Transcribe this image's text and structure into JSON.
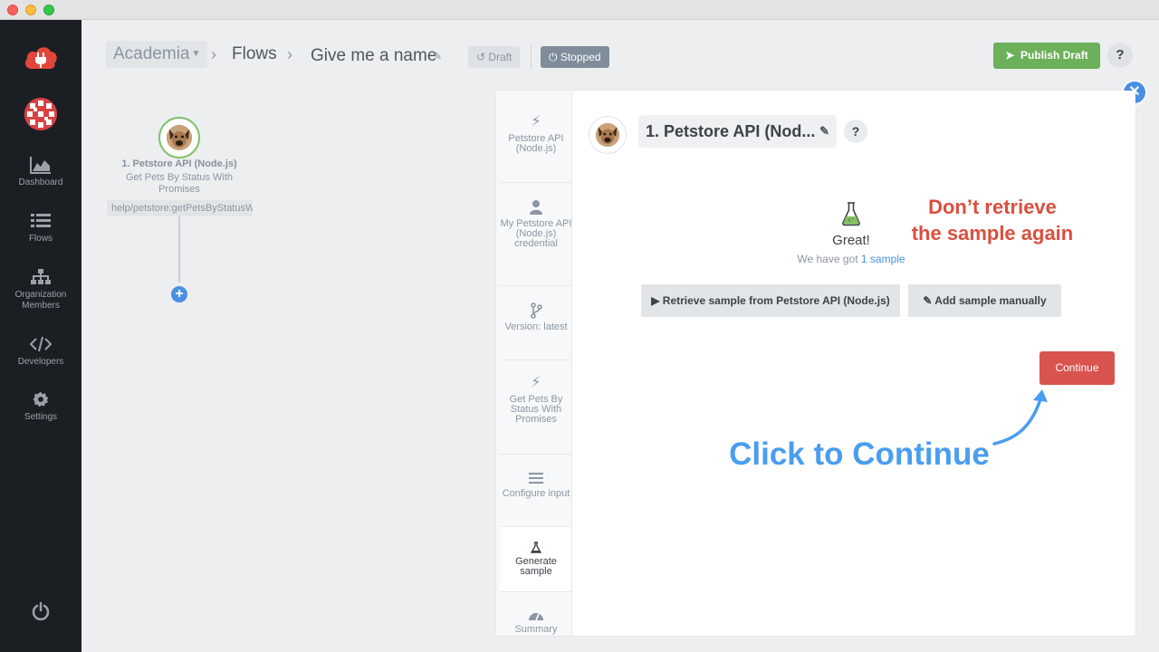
{
  "window": {
    "controls": [
      "close",
      "minimize",
      "zoom"
    ]
  },
  "sidebar": {
    "logo_icon": "cloud-plug-icon",
    "items": [
      {
        "label": "Dashboard",
        "icon": "area-chart-icon"
      },
      {
        "label": "Flows",
        "icon": "list-icon"
      },
      {
        "label": "Organization Members",
        "icon": "sitemap-icon"
      },
      {
        "label": "Developers",
        "icon": "code-icon"
      },
      {
        "label": "Settings",
        "icon": "gear-icon"
      }
    ],
    "power_icon": "power-icon"
  },
  "header": {
    "org": "Academia",
    "flows": "Flows",
    "flow_name": "Give me a name",
    "draft_badge": "Draft",
    "stopped_badge": "Stopped",
    "publish_label": "Publish Draft",
    "help_label": "?"
  },
  "canvas": {
    "node": {
      "title": "1. Petstore API (Node.js)",
      "subtitle": "Get Pets By Status With Promises",
      "path": "help/petstore:getPetsByStatusW"
    },
    "add_label": "+"
  },
  "panel": {
    "tabs": [
      {
        "label": "Petstore API (Node.js)",
        "icon": "bolt-icon"
      },
      {
        "label": "My Petstore API (Node.js) credential",
        "icon": "user-icon"
      },
      {
        "label": "Version: latest",
        "icon": "branch-icon"
      },
      {
        "label": "Get Pets By Status With Promises",
        "icon": "bolt-icon"
      },
      {
        "label": "Configure input",
        "icon": "lines-icon"
      },
      {
        "label": "Generate sample",
        "icon": "flask-icon",
        "active": true
      },
      {
        "label": "Summary",
        "icon": "gauge-icon"
      }
    ],
    "step_name": "1. Petstore API (Nod...",
    "help_label": "?",
    "close_label": "✕",
    "great": "Great!",
    "got_prefix": "We have got ",
    "got_link": "1 sample",
    "retrieve_label": "Retrieve sample from Petstore API (Node.js)",
    "manual_label": "Add sample manually",
    "continue_label": "Continue"
  },
  "annotations": {
    "red_line1": "Don’t retrieve",
    "red_line2": "the sample again",
    "blue": "Click to Continue",
    "red_color": "#db4f3f",
    "blue_color": "#4a9df0"
  }
}
